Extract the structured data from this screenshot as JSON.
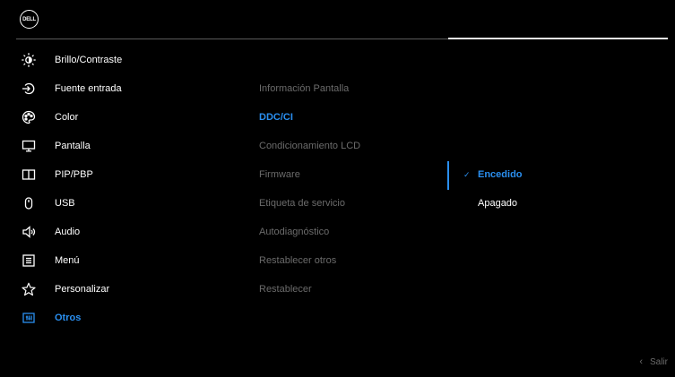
{
  "logo": {
    "text": "DELL",
    "icon": "dell-logo"
  },
  "menu": [
    {
      "label": "Brillo/Contraste",
      "icon": "brightness-icon"
    },
    {
      "label": "Fuente entrada",
      "icon": "input-source-icon"
    },
    {
      "label": "Color",
      "icon": "color-palette-icon"
    },
    {
      "label": "Pantalla",
      "icon": "monitor-icon"
    },
    {
      "label": "PIP/PBP",
      "icon": "pip-pbp-icon"
    },
    {
      "label": "USB",
      "icon": "usb-icon"
    },
    {
      "label": "Audio",
      "icon": "speaker-icon"
    },
    {
      "label": "Menú",
      "icon": "menu-icon"
    },
    {
      "label": "Personalizar",
      "icon": "star-icon"
    },
    {
      "label": "Otros",
      "icon": "others-icon",
      "active": true
    }
  ],
  "submenu": [
    {
      "label": "Información Pantalla"
    },
    {
      "label": "DDC/CI",
      "active": true
    },
    {
      "label": "Condicionamiento LCD"
    },
    {
      "label": "Firmware"
    },
    {
      "label": "Etiqueta de servicio"
    },
    {
      "label": "Autodiagnóstico"
    },
    {
      "label": "Restablecer otros"
    },
    {
      "label": "Restablecer"
    }
  ],
  "options": [
    {
      "label": "Encedido",
      "selected": true,
      "check": "✓"
    },
    {
      "label": "Apagado",
      "selected": false
    }
  ],
  "exit": {
    "label": "Salir",
    "chevron": "‹"
  },
  "colors": {
    "accent": "#2a8ff0",
    "muted": "#6b6b6b",
    "background": "#000000"
  }
}
